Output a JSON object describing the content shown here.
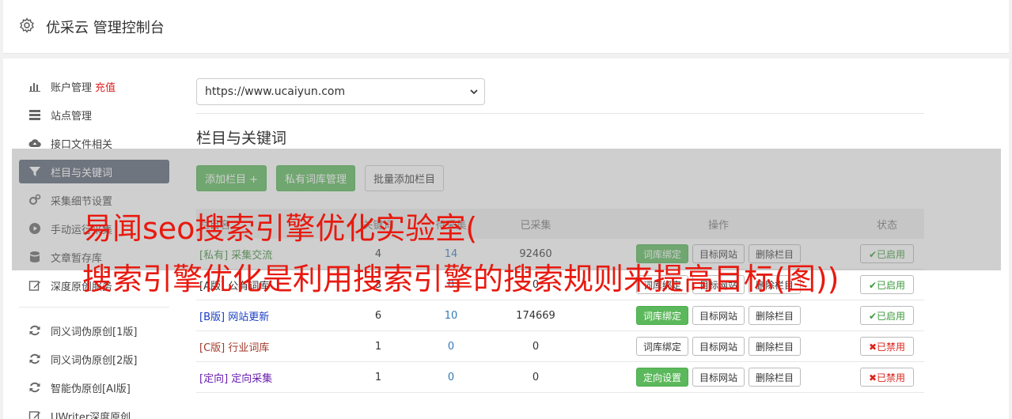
{
  "header": {
    "title": "优采云 管理控制台"
  },
  "sidebar": {
    "items": [
      {
        "label": "账户管理",
        "extra": "充值",
        "icon": "bar-chart-icon"
      },
      {
        "label": "站点管理",
        "icon": "server-icon"
      },
      {
        "label": "接口文件相关",
        "icon": "cloud-upload-icon"
      },
      {
        "label": "栏目与关键词",
        "icon": "filter-icon",
        "active": true
      },
      {
        "label": "采集细节设置",
        "icon": "gears-icon"
      },
      {
        "label": "手动运行采集",
        "icon": "play-icon"
      },
      {
        "label": "文章暂存库",
        "icon": "database-icon"
      },
      {
        "label": "深度原创服务",
        "icon": "edit-icon"
      }
    ],
    "items2": [
      {
        "label": "同义词伪原创[1版]",
        "icon": "refresh-icon"
      },
      {
        "label": "同义词伪原创[2版]",
        "icon": "refresh-icon"
      },
      {
        "label": "智能伪原创[AI版]",
        "icon": "refresh-icon"
      },
      {
        "label": "UWriter深度原创",
        "icon": "edit-icon"
      }
    ]
  },
  "site_select": {
    "value": "https://www.ucaiyun.com"
  },
  "section": {
    "title": "栏目与关键词"
  },
  "buttons": {
    "add_column": "添加栏目 +",
    "private_lib": "私有词库管理",
    "batch_add": "批量添加栏目"
  },
  "table": {
    "headers": {
      "name": "栏目名",
      "keywords": "关键词",
      "pending": "待采集",
      "collected": "已采集",
      "actions": "操作",
      "status": "状态"
    },
    "rows": [
      {
        "tag": "[私有]",
        "name": "采集交流",
        "kw": "4",
        "pending": "14",
        "collected": "92460",
        "bind": "词库绑定",
        "bind_green": true,
        "target": "目标网站",
        "delete": "删除栏目",
        "status": "✔已启用",
        "on": true,
        "color": "#3c8d3c"
      },
      {
        "tag": "[A版]",
        "name": "公有词库",
        "kw": "3",
        "pending": "0",
        "collected": "0",
        "bind": "词库绑定",
        "bind_green": false,
        "target": "目标网站",
        "delete": "删除栏目",
        "status": "✔已启用",
        "on": true,
        "color": "#333333"
      },
      {
        "tag": "[B版]",
        "name": "网站更新",
        "kw": "6",
        "pending": "10",
        "collected": "174669",
        "bind": "词库绑定",
        "bind_green": true,
        "target": "目标网站",
        "delete": "删除栏目",
        "status": "✔已启用",
        "on": true,
        "color": "#1a3fc2"
      },
      {
        "tag": "[C版]",
        "name": "行业词库",
        "kw": "1",
        "pending": "0",
        "collected": "0",
        "bind": "词库绑定",
        "bind_green": false,
        "target": "目标网站",
        "delete": "删除栏目",
        "status": "✖已禁用",
        "on": false,
        "color": "#a33a2a"
      },
      {
        "tag": "[定向]",
        "name": "定向采集",
        "kw": "1",
        "pending": "0",
        "collected": "0",
        "bind": "定向设置",
        "bind_green": true,
        "target": "目标网站",
        "delete": "删除栏目",
        "status": "✖已禁用",
        "on": false,
        "color": "#6a1fb0"
      }
    ]
  },
  "watermark": {
    "line1": "易闻seo搜索引擎优化实验室(",
    "line2": "搜索引擎优化是利用搜索引擎的搜索规则来提高目标(图))"
  }
}
